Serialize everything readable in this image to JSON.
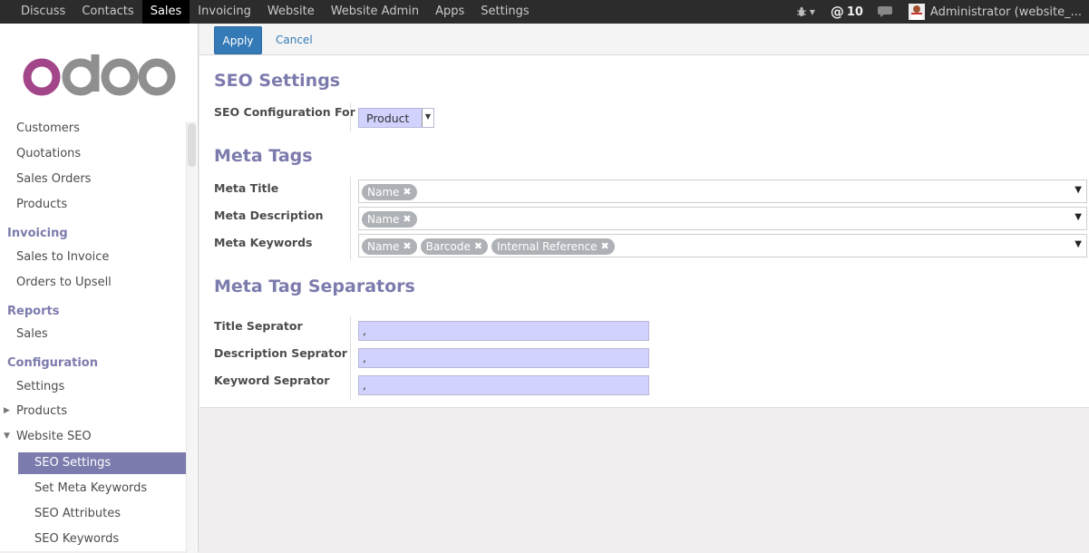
{
  "topbar": {
    "menu": [
      "Discuss",
      "Contacts",
      "Sales",
      "Invoicing",
      "Website",
      "Website Admin",
      "Apps",
      "Settings"
    ],
    "active_menu": "Sales",
    "mention_count": "10",
    "user": "Administrator (website_..."
  },
  "logo": "odoo",
  "sidebar": {
    "sales_items": [
      "Customers",
      "Quotations",
      "Sales Orders",
      "Products"
    ],
    "invoicing_header": "Invoicing",
    "invoicing_items": [
      "Sales to Invoice",
      "Orders to Upsell"
    ],
    "reports_header": "Reports",
    "reports_items": [
      "Sales"
    ],
    "configuration_header": "Configuration",
    "configuration_items": [
      "Settings",
      "Products",
      "Website SEO"
    ],
    "website_seo_items": [
      "SEO Settings",
      "Set Meta Keywords",
      "SEO Attributes",
      "SEO Keywords"
    ],
    "active_item": "SEO Settings"
  },
  "control_panel": {
    "apply": "Apply",
    "cancel": "Cancel"
  },
  "form": {
    "seo_settings_title": "SEO Settings",
    "seo_config_label": "SEO Configuration For",
    "seo_config_value": "Product",
    "meta_tags_title": "Meta Tags",
    "meta_title_label": "Meta Title",
    "meta_title_tags": [
      "Name"
    ],
    "meta_description_label": "Meta Description",
    "meta_description_tags": [
      "Name"
    ],
    "meta_keywords_label": "Meta Keywords",
    "meta_keywords_tags": [
      "Name",
      "Barcode",
      "Internal Reference"
    ],
    "separators_title": "Meta Tag Separators",
    "title_separator_label": "Title Seprator",
    "title_separator_value": ",",
    "description_separator_label": "Description Seprator",
    "description_separator_value": ",",
    "keyword_separator_label": "Keyword Seprator",
    "keyword_separator_value": ","
  },
  "colors": {
    "accent": "#7c7bad",
    "primary_button": "#337ab7",
    "input_highlight": "#d2d2ff",
    "logo_o": "#a24689",
    "logo_doo": "#8f8f8f"
  }
}
